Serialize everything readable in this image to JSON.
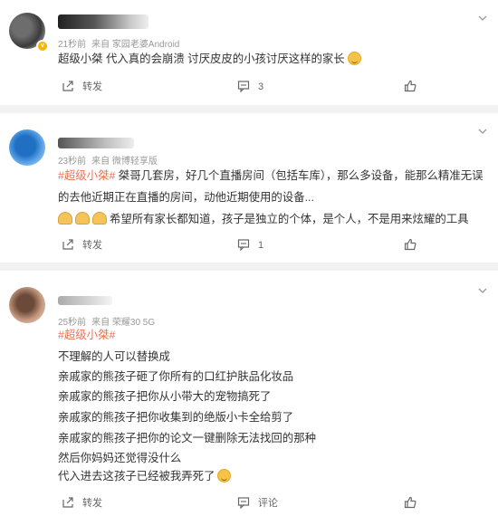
{
  "comments": [
    {
      "meta": [
        "21秒前",
        "来自 家园老婆Android"
      ],
      "lines": [
        {
          "tag": "",
          "text": "超级小桀 代入真的会崩溃 讨厌皮皮的小孩讨厌这样的家长",
          "emoji": "smile"
        }
      ],
      "actions": {
        "share": "转发",
        "comment": "3",
        "like": ""
      }
    },
    {
      "meta": [
        "23秒前",
        "来自 微博轻享版"
      ],
      "lines": [
        {
          "tag": "#超级小桀#",
          "text": " 桀哥几套房，好几个直播房间（包括车库），那么多设备，能那么精准无误"
        },
        {
          "tag": "",
          "text": "的去他近期正在直播的房间，动他近期使用的设备..."
        },
        {
          "tag": "",
          "text": "希望所有家长都知道，孩子是独立的个体，是个人，不是用来炫耀的工具",
          "hands": 3
        }
      ],
      "actions": {
        "share": "转发",
        "comment": "1",
        "like": ""
      }
    },
    {
      "meta": [
        "25秒前",
        "来自 荣耀30 5G"
      ],
      "lines": [
        {
          "tag": "#超级小桀#",
          "text": ""
        },
        {
          "tag": "",
          "text": "不理解的人可以替换成"
        },
        {
          "tag": "",
          "text": "亲戚家的熊孩子砸了你所有的口红护肤品化妆品"
        },
        {
          "tag": "",
          "text": "亲戚家的熊孩子把你从小带大的宠物搞死了"
        },
        {
          "tag": "",
          "text": "亲戚家的熊孩子把你收集到的绝版小卡全给剪了"
        },
        {
          "tag": "",
          "text": "亲戚家的熊孩子把你的论文一键删除无法找回的那种"
        },
        {
          "tag": "",
          "text": "然后你妈妈还觉得没什么"
        },
        {
          "tag": "",
          "text": "代入进去这孩子已经被我弄死了",
          "emoji": "grin"
        }
      ],
      "actions": {
        "share": "转发",
        "comment": "评论",
        "like": ""
      }
    }
  ],
  "icons": {
    "share": "share-icon",
    "comment": "comment-icon",
    "like": "thumbs-up-icon",
    "more": "chevron-down-icon",
    "verified": "verified-badge-icon"
  },
  "colors": {
    "tag": "#eb7350",
    "meta": "#999999",
    "background": "#f2f2f2"
  }
}
